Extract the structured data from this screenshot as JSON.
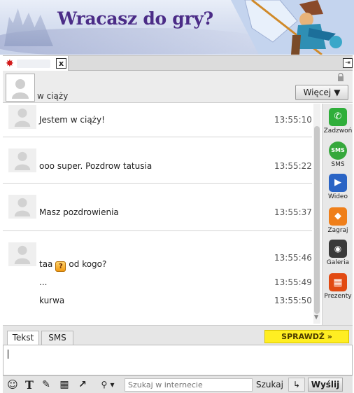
{
  "banner": {
    "title": "Wracasz do gry?"
  },
  "chat_tab": {
    "close_label": "x",
    "restore_icon": "restore-window-icon"
  },
  "profile": {
    "status": "w ciąży",
    "more_label": "Więcej",
    "more_icon": "chevron-down-icon"
  },
  "messages": [
    {
      "lines": [
        {
          "text": "Jestem w ciąży!",
          "time": "13:55:10"
        }
      ]
    },
    {
      "lines": [
        {
          "text": "ooo super. Pozdrow tatusia",
          "time": "13:55:22"
        }
      ]
    },
    {
      "lines": [
        {
          "text": "Masz pozdrowienia",
          "time": "13:55:37"
        }
      ]
    },
    {
      "lines": [
        {
          "pre": "taa",
          "emoticon": "?",
          "post": "od kogo?",
          "time": "13:55:46"
        },
        {
          "text": "...",
          "time": "13:55:49"
        },
        {
          "text": "kurwa",
          "time": "13:55:50"
        }
      ]
    }
  ],
  "sidebar": {
    "items": [
      {
        "label": "Zadzwoń",
        "icon": "phone-icon",
        "color": "#2fae3a"
      },
      {
        "label": "SMS",
        "icon": "sms-icon",
        "color": "#36a83c"
      },
      {
        "label": "Wideo",
        "icon": "video-icon",
        "color": "#2a64c5"
      },
      {
        "label": "Zagraj",
        "icon": "game-icon",
        "color": "#ef7f1a"
      },
      {
        "label": "Galeria",
        "icon": "camera-icon",
        "color": "#333333"
      },
      {
        "label": "Prezenty",
        "icon": "gift-icon",
        "color": "#e24a12"
      }
    ]
  },
  "compose": {
    "tabs": [
      "Tekst",
      "SMS"
    ],
    "active_tab": "Tekst",
    "check_label": "SPRAWDŹ »"
  },
  "toolbar": {
    "icons": [
      "emoticon-icon",
      "text-format-icon",
      "tools-icon",
      "gift-icon",
      "share-icon",
      "search-icon"
    ],
    "search_placeholder": "Szukaj w internecie",
    "search_label": "Szukaj",
    "send_label": "Wyślij"
  }
}
